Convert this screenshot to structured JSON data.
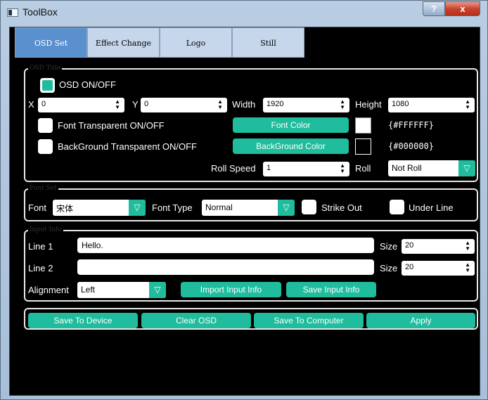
{
  "window": {
    "title": "ToolBox",
    "help_label": "?",
    "close_label": "x"
  },
  "tabs": [
    {
      "label": "OSD Set"
    },
    {
      "label": "Effect Change"
    },
    {
      "label": "Logo"
    },
    {
      "label": "Still"
    }
  ],
  "osd_title": {
    "group_label": "OSD Title",
    "osd_onoff": {
      "label": "OSD ON/OFF",
      "checked": true
    },
    "x": {
      "label": "X",
      "value": "0"
    },
    "y": {
      "label": "Y",
      "value": "0"
    },
    "width": {
      "label": "Width",
      "value": "1920"
    },
    "height": {
      "label": "Height",
      "value": "1080"
    },
    "font_transparent": {
      "label": "Font Transparent ON/OFF",
      "checked": false
    },
    "bg_transparent": {
      "label": "BackGround Transparent ON/OFF",
      "checked": false
    },
    "font_color": {
      "button": "Font Color",
      "swatch": "#ffffff",
      "hex": "{#FFFFFF}"
    },
    "bg_color": {
      "button": "BackGround Color",
      "swatch": "#000000",
      "hex": "{#000000}"
    },
    "roll_speed": {
      "label": "Roll Speed",
      "value": "1"
    },
    "roll": {
      "label": "Roll",
      "value": "Not Roll"
    }
  },
  "font_set": {
    "group_label": "Font Set",
    "font": {
      "label": "Font",
      "value": "宋体"
    },
    "font_type": {
      "label": "Font Type",
      "value": "Normal"
    },
    "strike_out": {
      "label": "Strike Out",
      "checked": false
    },
    "under_line": {
      "label": "Under Line",
      "checked": false
    }
  },
  "input_info": {
    "group_label": "Input Info",
    "line1": {
      "label": "Line 1",
      "value": "Hello.",
      "size_label": "Size",
      "size": "20"
    },
    "line2": {
      "label": "Line 2",
      "value": "",
      "size_label": "Size",
      "size": "20"
    },
    "alignment": {
      "label": "Alignment",
      "value": "Left"
    },
    "import_button": "Import Input Info",
    "save_button": "Save Input Info"
  },
  "actions": {
    "save_to_device": "Save To Device",
    "clear_osd": "Clear OSD",
    "save_to_computer": "Save To Computer",
    "apply": "Apply"
  },
  "colors": {
    "accent": "#1fbd9d",
    "tab_active": "#5b90cf",
    "tab_inactive": "#c6d7eb"
  }
}
